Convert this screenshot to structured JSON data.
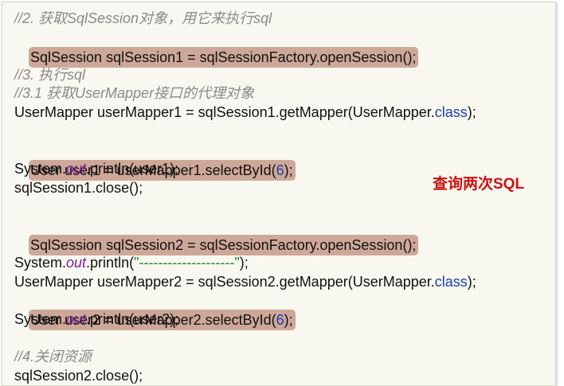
{
  "code": {
    "l1_comment": "//2. 获取SqlSession对象，用它来执行sql",
    "l2_code": "SqlSession sqlSession1 = sqlSessionFactory.openSession();",
    "l3_comment": "//3. 执行sql",
    "l4_comment": "//3.1 获取UserMapper接口的代理对象",
    "l5_pre": "UserMapper userMapper1 = sqlSession1.getMapper(UserMapper.",
    "l5_kw": "class",
    "l5_post": ");",
    "l6_pre": "User user1 = userMapper1.selectById(",
    "l6_num": "6",
    "l6_post": ");",
    "l7_pre": "System.",
    "l7_field": "out",
    "l7_post": ".println(user1);",
    "l8_code": "sqlSession1.close();",
    "l9_code": "SqlSession sqlSession2 = sqlSessionFactory.openSession();",
    "l10_pre": "System.",
    "l10_field": "out",
    "l10_mid": ".println(",
    "l10_str": "\"--------------------\"",
    "l10_post": ");",
    "l11_pre": "UserMapper userMapper2 = sqlSession2.getMapper(UserMapper.",
    "l11_kw": "class",
    "l11_post": ");",
    "l12_pre": "User user2 = userMapper2.selectById(",
    "l12_num": "6",
    "l12_post": ");",
    "l13_pre": "System.",
    "l13_field": "out",
    "l13_post": ".println(user2);",
    "l14_comment": "//4.关闭资源",
    "l15_code": "sqlSession2.close();"
  },
  "annotation": {
    "text": "查询两次SQL",
    "color": "#cc1111"
  },
  "colors": {
    "highlight": "#cda898",
    "background": "#f8f8f0",
    "keyword": "#1a3fb0",
    "field": "#7a1fa0",
    "string": "#1a8a1a",
    "comment": "#8a8a8a"
  }
}
